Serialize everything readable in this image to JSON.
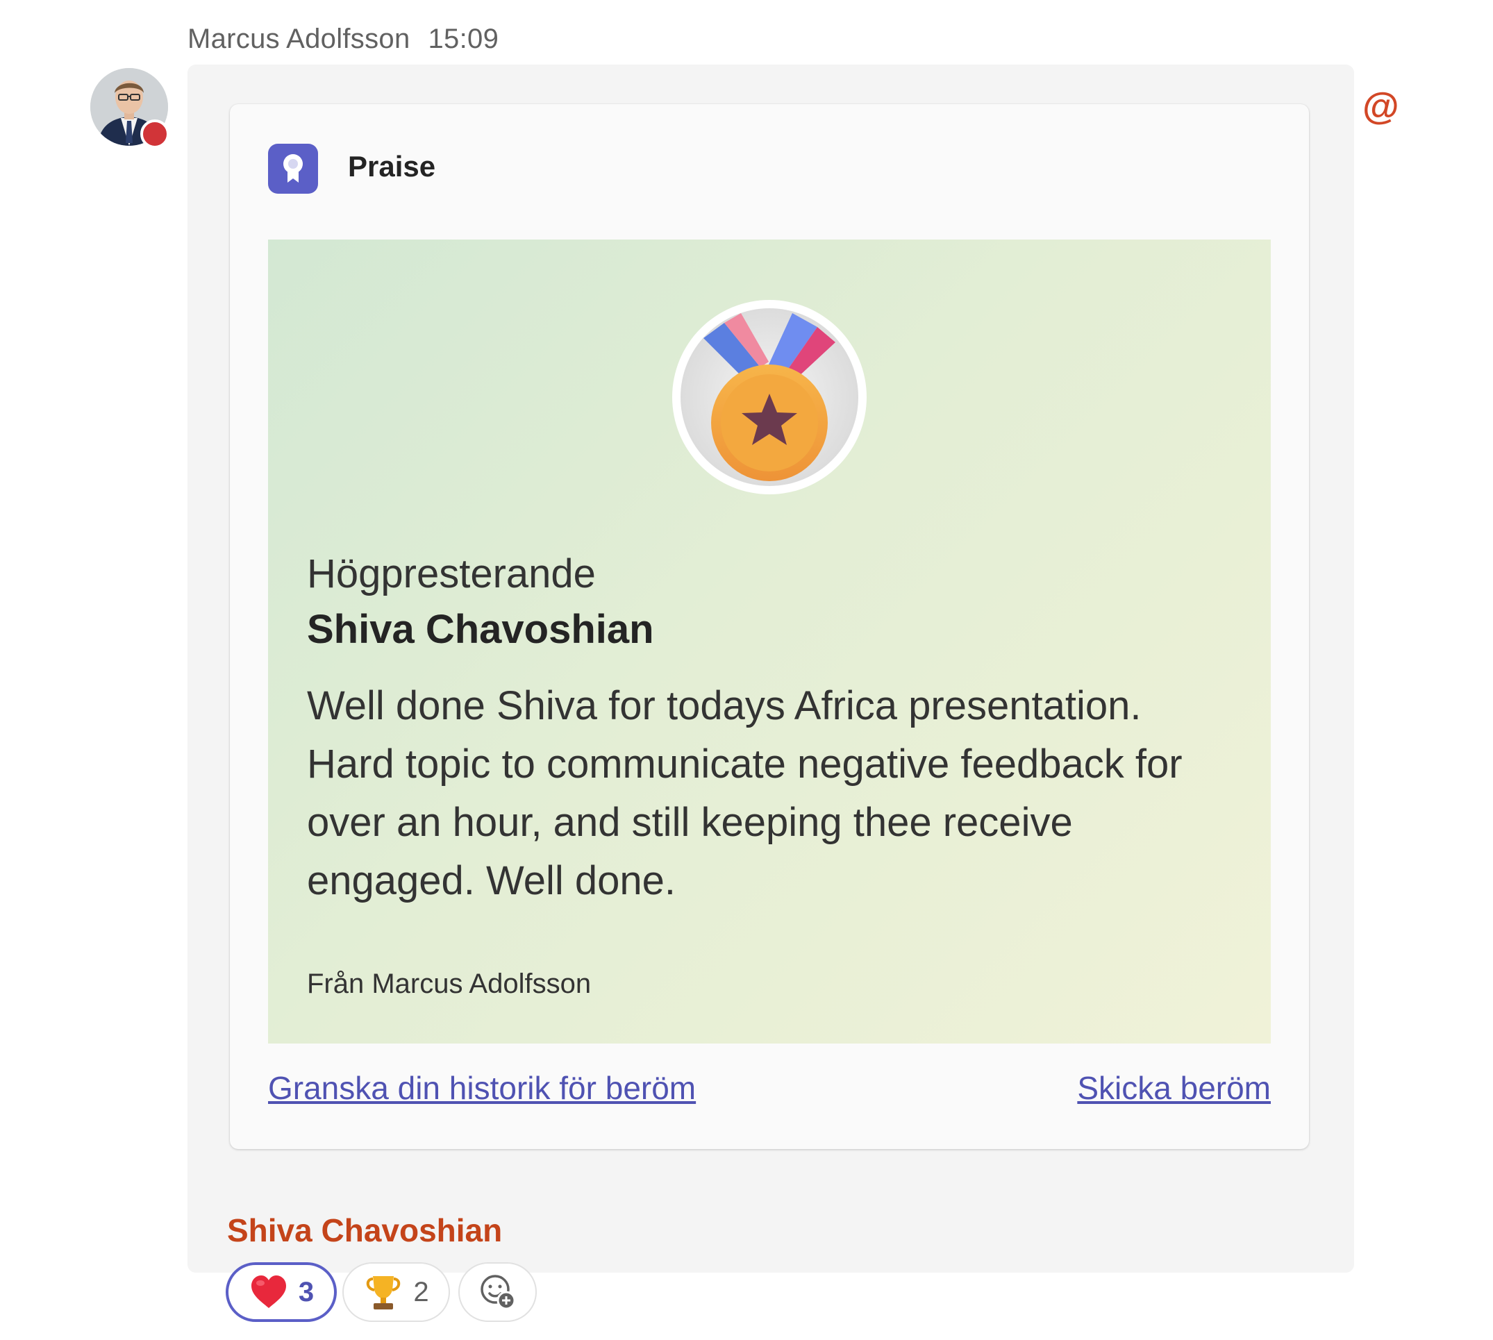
{
  "message": {
    "sender_name": "Marcus Adolfsson",
    "timestamp": "15:09",
    "avatar_icon": "person-photo-avatar",
    "presence_status_color": "#d13438",
    "mention_icon": "at-mention-icon",
    "mention_color": "#d24726"
  },
  "card": {
    "app_icon": "praise-badge-icon",
    "app_name": "Praise",
    "badge_icon": "medal-star-icon",
    "award_name": "Högpresterande",
    "recipient": "Shiva Chavoshian",
    "body": "Well done Shiva for todays Africa presentation. Hard topic to communicate negative feedback for over an hour, and still keeping thee receive engaged. Well done.",
    "from_line": "Från Marcus Adolfsson",
    "link_history": "Granska din historik för beröm",
    "link_send": "Skicka beröm",
    "accent_color": "#5b5fc7"
  },
  "mention": {
    "name": "Shiva Chavoshian",
    "color": "#c4441a"
  },
  "reactions": [
    {
      "icon": "heart-icon",
      "count": "3",
      "selected": true
    },
    {
      "icon": "trophy-icon",
      "count": "2",
      "selected": false
    },
    {
      "icon": "add-reaction-icon"
    }
  ]
}
